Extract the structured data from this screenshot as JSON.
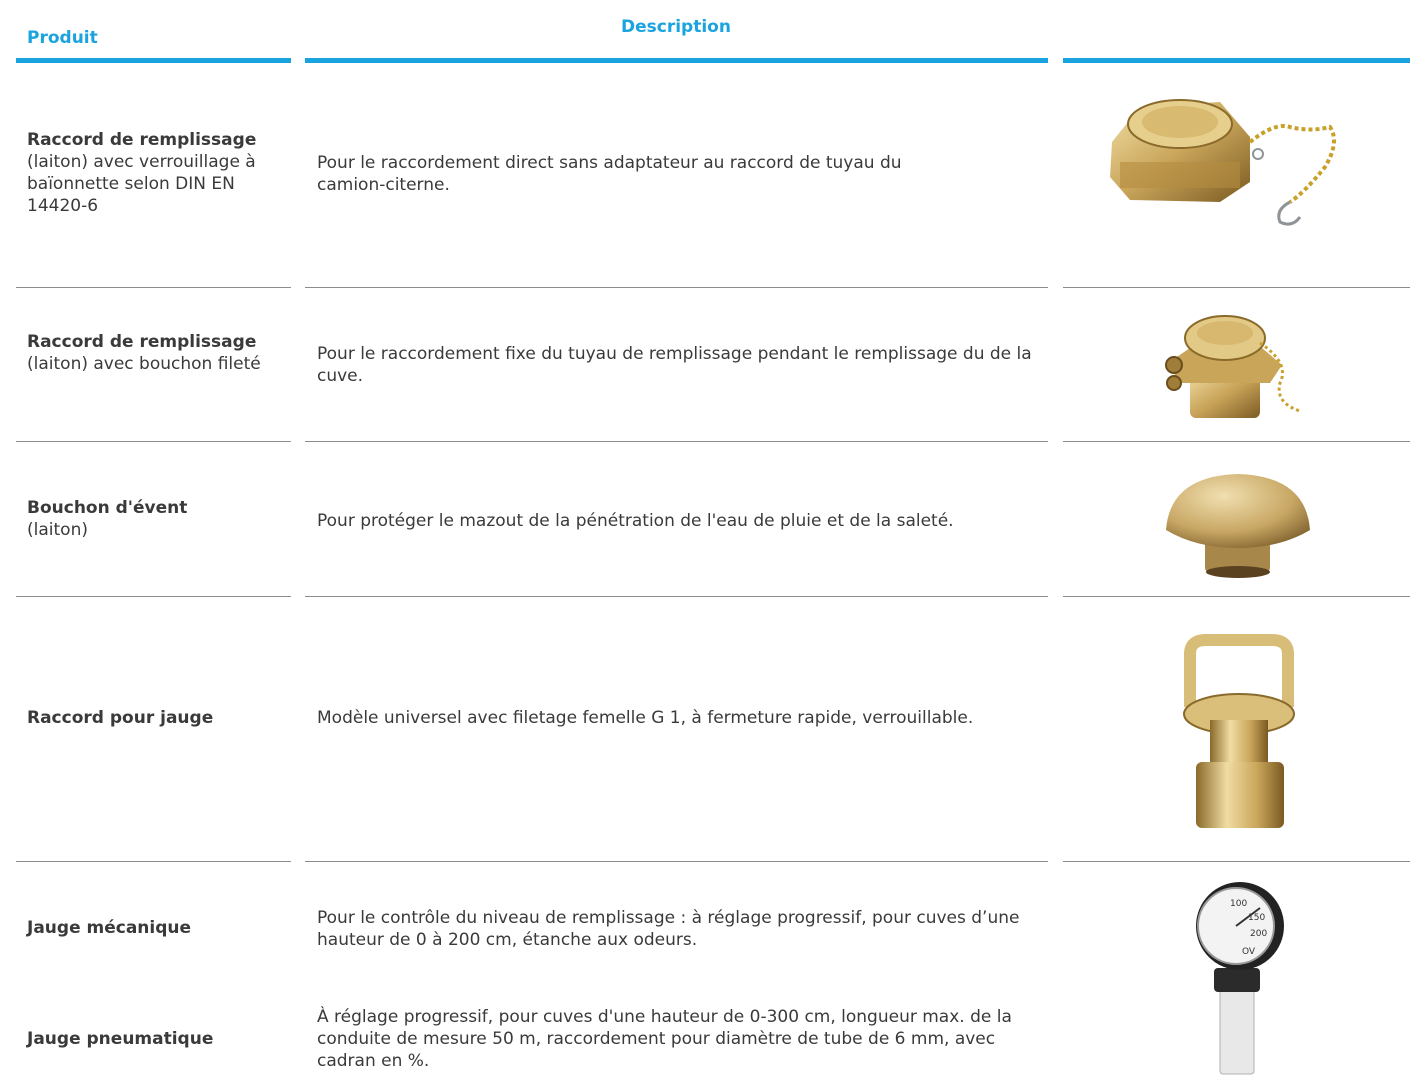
{
  "headers": {
    "product": "Produit",
    "description": "Description"
  },
  "rows": [
    {
      "name": "Raccord de remplissage",
      "sub": "(laiton) avec verrouillage à baïonnette selon DIN EN 14420-6",
      "description": "Pour le raccordement direct sans adaptateur au raccord de tuyau du camion-citerne.",
      "image_icon": "bayonet-fill-coupling-with-chain"
    },
    {
      "name": "Raccord de remplissage",
      "sub": "(laiton) avec bouchon fileté",
      "description": "Pour le raccordement fixe du tuyau de remplissage pendant le remplissage du de la cuve.",
      "image_icon": "threaded-cap-coupling"
    },
    {
      "name": "Bouchon d'évent",
      "sub": "(laiton)",
      "description": "Pour protéger le mazout de la pénétration de l'eau de pluie et de la saleté.",
      "image_icon": "vent-cap"
    },
    {
      "name": "Raccord pour jauge",
      "sub": "",
      "description": "Modèle universel avec filetage femelle G 1, à fermeture rapide, verrouillable.",
      "image_icon": "gauge-coupling"
    },
    {
      "name": "Jauge mécanique",
      "sub": "",
      "description": "Pour le contrôle du niveau de remplissage : à réglage progressif, pour cuves d’une hauteur de 0 à 200 cm, étanche aux odeurs.",
      "image_icon": "level-gauge"
    },
    {
      "name": "Jauge pneumatique",
      "sub": "",
      "description": "À réglage progressif, pour cuves d'une hauteur de 0-300 cm, longueur max. de la conduite de mesure 50 m, raccordement pour diamètre de tube de 6 mm, avec cadran en %.",
      "image_icon": ""
    }
  ],
  "gauge_dial": {
    "tick_1": "100",
    "tick_2": "150",
    "tick_3": "200",
    "brand": "OV"
  },
  "colors": {
    "accent": "#1aa3de",
    "separator": "#8c8c8c",
    "text": "#3a3a3a",
    "brass": "#c9a55a"
  }
}
